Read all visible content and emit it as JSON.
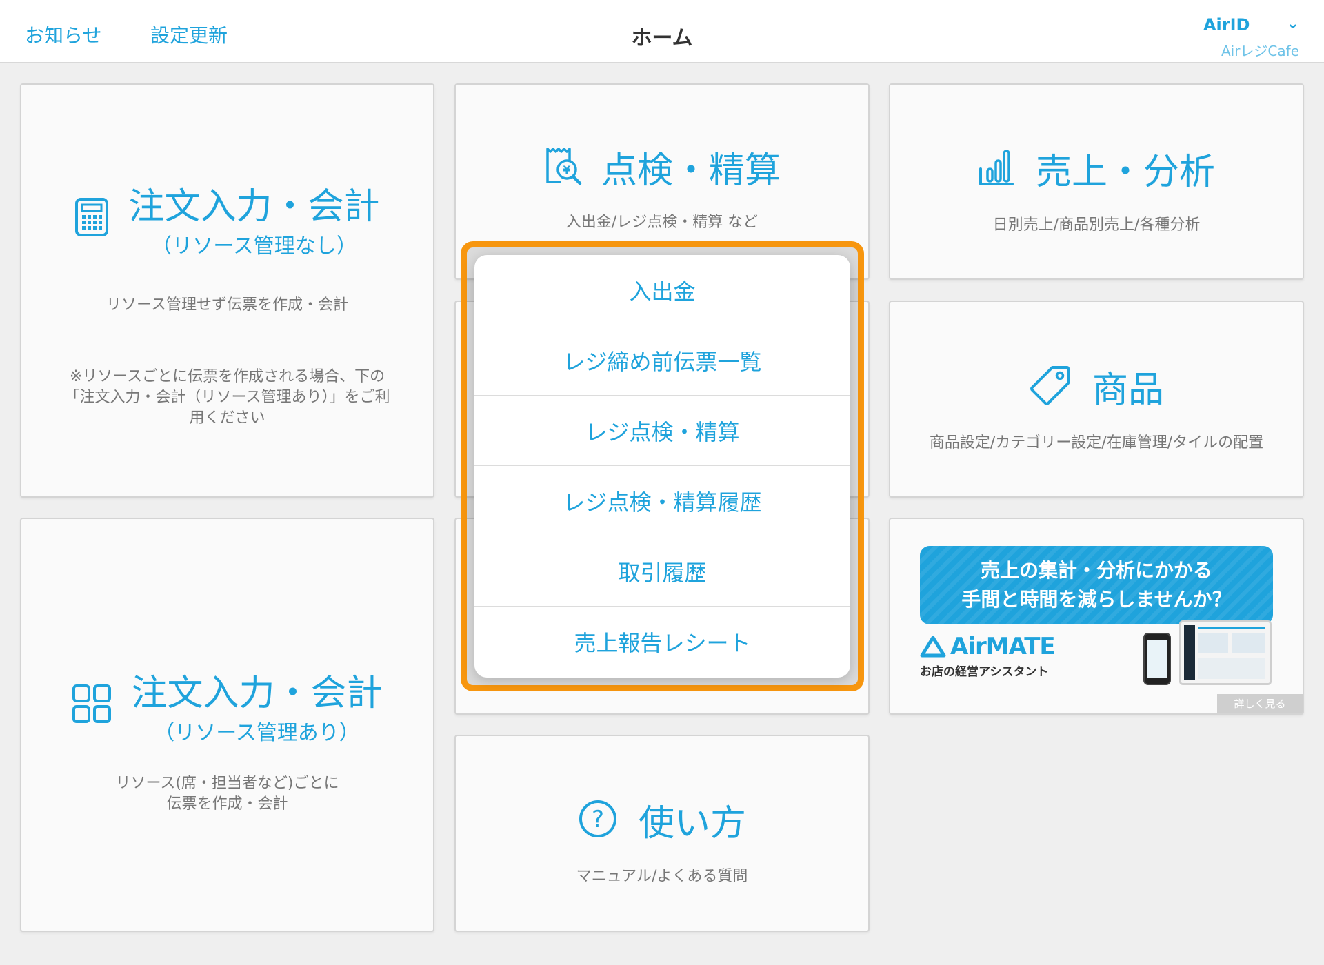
{
  "header": {
    "notifications": "お知らせ",
    "settings_update": "設定更新",
    "title": "ホーム",
    "account_id": "AirID",
    "store_name": "AirレジCafe"
  },
  "tiles": {
    "order_no_resource": {
      "title": "注文入力・会計",
      "subtitle": "（リソース管理なし）",
      "desc": "リソース管理せず伝票を作成・会計",
      "note_lines": [
        "※リソースごとに伝票を作成される場合、下の",
        "「注文入力・会計（リソース管理あり）」をご利",
        "用ください"
      ],
      "icon": "calculator-icon"
    },
    "inspection": {
      "title": "点検・精算",
      "desc": "入出金/レジ点検・精算 など",
      "icon": "receipt-yen-search-icon"
    },
    "sales": {
      "title": "売上・分析",
      "desc": "日別売上/商品別売上/各種分析",
      "icon": "bar-chart-icon"
    },
    "products": {
      "title": "商品",
      "desc": "商品設定/カテゴリー設定/在庫管理/タイルの配置",
      "icon": "tag-icon"
    },
    "order_with_resource": {
      "title": "注文入力・会計",
      "subtitle": "（リソース管理あり）",
      "desc_lines": [
        "リソース(席・担当者など)ごとに",
        "伝票を作成・会計"
      ],
      "icon": "grid-icon"
    },
    "help": {
      "title": "使い方",
      "desc": "マニュアル/よくある質問",
      "icon": "question-circle-icon"
    }
  },
  "popover_menu": [
    {
      "label": "入出金"
    },
    {
      "label": "レジ締め前伝票一覧"
    },
    {
      "label": "レジ点検・精算"
    },
    {
      "label": "レジ点検・精算履歴"
    },
    {
      "label": "取引履歴"
    },
    {
      "label": "売上報告レシート"
    }
  ],
  "ad": {
    "banner_lines": [
      "売上の集計・分析にかかる",
      "手間と時間を減らしませんか？"
    ],
    "logo_text": "AirMATE",
    "tagline": "お店の経営アシスタント",
    "more_label": "詳しく見る"
  },
  "colors": {
    "accent": "#1fa3dc",
    "highlight": "#f7960f",
    "background": "#efefef"
  }
}
